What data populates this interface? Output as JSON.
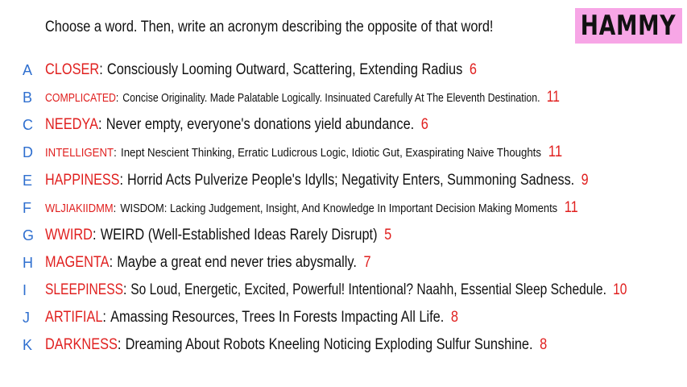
{
  "badge": "HAMMY",
  "prompt": "Choose a word. Then, write an acronym describing the opposite of that word!",
  "rows": [
    {
      "letter": "A",
      "word": "CLOSER",
      "acronym": "Consciously Looming Outward, Scattering, Extending Radius",
      "count": "6"
    },
    {
      "letter": "B",
      "word": "COMPLICATED",
      "acronym": "Concise Originality. Made Palatable Logically. Insinuated Carefully At The Eleventh Destination.",
      "count": "11"
    },
    {
      "letter": "C",
      "word": "NEEDYA",
      "acronym": "Never empty, everyone's donations yield abundance.",
      "count": "6"
    },
    {
      "letter": "D",
      "word": "INTELLIGENT",
      "acronym": "Inept Nescient Thinking, Erratic Ludicrous Logic, Idiotic Gut, Exaspirating Naive Thoughts",
      "count": "11"
    },
    {
      "letter": "E",
      "word": "HAPPINESS",
      "acronym": "Horrid Acts Pulverize People's Idylls; Negativity Enters, Summoning Sadness.",
      "count": "9"
    },
    {
      "letter": "F",
      "word": "WLJIAKIIDMM",
      "acronym": "WISDOM: Lacking Judgement, Insight, And Knowledge In Important Decision Making Moments",
      "count": "11"
    },
    {
      "letter": "G",
      "word": "WWIRD",
      "acronym": "WEIRD (Well-Established Ideas Rarely Disrupt)",
      "count": "5"
    },
    {
      "letter": "H",
      "word": "MAGENTA",
      "acronym": "Maybe a great end never tries abysmally.",
      "count": "7"
    },
    {
      "letter": "I",
      "word": "SLEEPINESS",
      "acronym": "So Loud, Energetic, Excited, Powerful! Intentional? Naahh, Essential Sleep Schedule.",
      "count": "10"
    },
    {
      "letter": "J",
      "word": "ARTIFIAL",
      "acronym": "Amassing Resources, Trees In Forests Impacting All Life.",
      "count": "8"
    },
    {
      "letter": "K",
      "word": "DARKNESS",
      "acronym": "Dreaming About Robots Kneeling Noticing Exploding Sulfur Sunshine.",
      "count": "8"
    }
  ]
}
